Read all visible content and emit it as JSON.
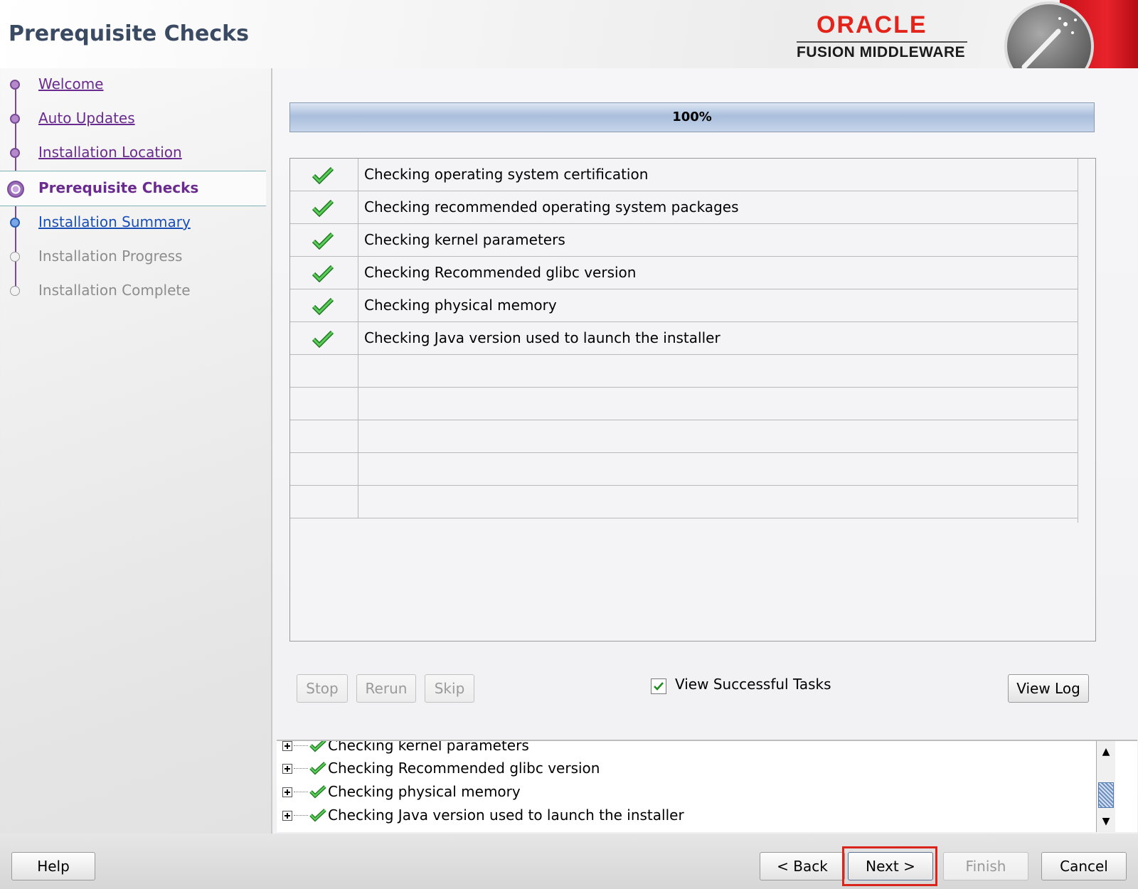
{
  "header": {
    "page_title": "Prerequisite Checks",
    "logo_brand": "ORACLE",
    "logo_product": "FUSION MIDDLEWARE"
  },
  "nav": {
    "items": [
      {
        "label": "Welcome",
        "state": "visited"
      },
      {
        "label": "Auto Updates",
        "state": "visited"
      },
      {
        "label": "Installation Location",
        "state": "visited"
      },
      {
        "label": "Prerequisite Checks",
        "state": "current"
      },
      {
        "label": "Installation Summary",
        "state": "next"
      },
      {
        "label": "Installation Progress",
        "state": "disabled"
      },
      {
        "label": "Installation Complete",
        "state": "disabled"
      }
    ]
  },
  "progress": {
    "value": 1.0,
    "label": "100%"
  },
  "checks": {
    "rows": [
      {
        "status": "passed",
        "label": "Checking operating system certification"
      },
      {
        "status": "passed",
        "label": "Checking recommended operating system packages"
      },
      {
        "status": "passed",
        "label": "Checking kernel parameters"
      },
      {
        "status": "passed",
        "label": "Checking Recommended glibc version"
      },
      {
        "status": "passed",
        "label": "Checking physical memory"
      },
      {
        "status": "passed",
        "label": "Checking Java version used to launch the installer"
      }
    ],
    "empty_rows": 5
  },
  "controls": {
    "stop_label": "Stop",
    "rerun_label": "Rerun",
    "skip_label": "Skip",
    "view_successful_label": "View Successful Tasks",
    "view_successful_checked": true,
    "view_log_label": "View Log"
  },
  "log": {
    "items": [
      "Checking kernel parameters",
      "Checking Recommended glibc version",
      "Checking physical memory",
      "Checking Java version used to launch the installer"
    ]
  },
  "footer": {
    "help_label": "Help",
    "back_label": "< Back",
    "next_label": "Next >",
    "finish_label": "Finish",
    "cancel_label": "Cancel"
  },
  "colors": {
    "title": "#3b4a63",
    "oracle_red": "#e3241b",
    "nav_visited": "#6a2b8f",
    "nav_next": "#1a4fb8",
    "check_green": "#2e9e2e",
    "highlight": "#d9251c"
  },
  "icons": {
    "check": "green-checkmark-icon",
    "expander": "plus-expander-icon"
  }
}
